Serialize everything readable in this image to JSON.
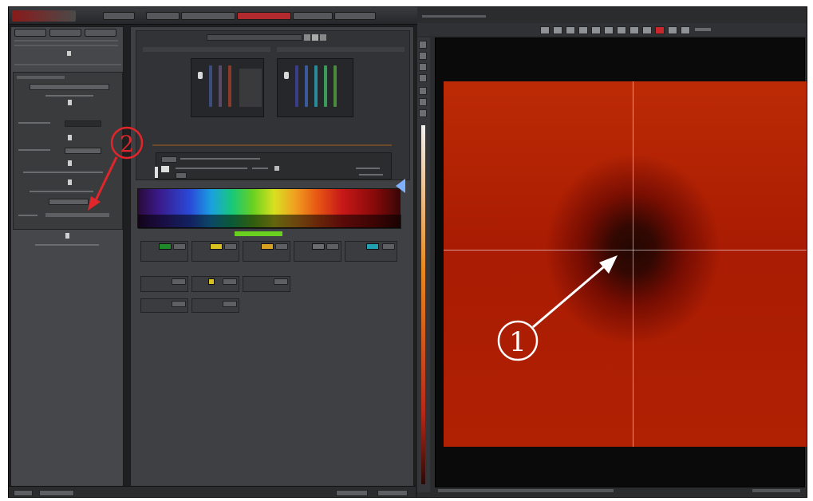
{
  "annotations": {
    "marker_1": "1",
    "marker_2": "2"
  },
  "colors": {
    "accent": "#b22a2e",
    "annotation_red": "#e0262a",
    "annotation_white": "#ffffff",
    "heatmap_edge": "#e8841c",
    "heatmap_center": "#2a1210"
  },
  "icons": {
    "crosshair": "crosshair-icon",
    "arrow_white": "arrow-icon",
    "arrow_red": "arrow-icon",
    "spectrum_pointer": "triangle-icon"
  }
}
